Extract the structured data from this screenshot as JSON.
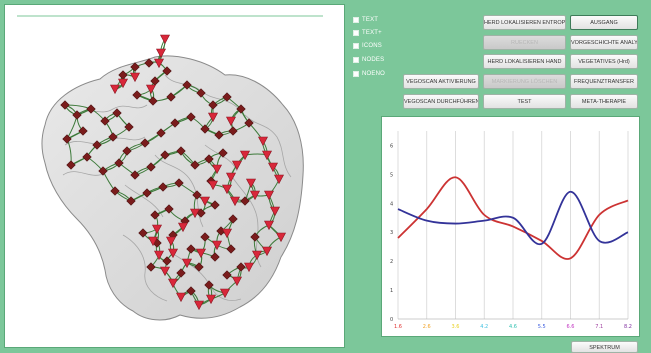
{
  "checks": [
    {
      "label": "TEXT"
    },
    {
      "label": "TEXT+"
    },
    {
      "label": "ICONS"
    },
    {
      "label": "NODES"
    },
    {
      "label": "NOENO"
    }
  ],
  "buttons": {
    "herd_entropie": "HERD LOKALISIEREN ENTROPIE",
    "ausgang": "AUSGANG",
    "blank_disabled": "RUECKEN",
    "vorgeschichte": "VORGESCHICHTE ANALYSE",
    "herd_hand": "HERD LOKALISIEREN HAND",
    "vegetativ": "VEGETATIVES (Hrd)",
    "vegoscan_aktivierung": "VEGOSCAN AKTIVIERUNG",
    "markierungen_loeschen": "MARKIERUNG LÖSCHEN",
    "frequenztransfer": "FREQUENZTRANSFER",
    "vegoscan_durchfuehren": "VEGOSCAN DURCHFÜHREN",
    "test": "TEST",
    "meta_therapie": "META-THERAPIE",
    "spektrum": "SPEKTRUM"
  },
  "chart_data": {
    "type": "line",
    "x": [
      0,
      1,
      2,
      3,
      4,
      5,
      6,
      7,
      8
    ],
    "x_tick_labels": [
      "1.6",
      "2.6",
      "3.6",
      "4.2",
      "4.6",
      "5.5",
      "6.6",
      "7.1",
      "8.2"
    ],
    "x_tick_colors": [
      "#e03030",
      "#f0a020",
      "#e8d020",
      "#40c0e0",
      "#30c0b0",
      "#4060e0",
      "#c030c0",
      "#a040a0",
      "#8030a0"
    ],
    "y_tick_labels": [
      "0",
      "1",
      "2",
      "3",
      "4",
      "5",
      "6"
    ],
    "ylim": [
      0,
      6.5
    ],
    "grid": "vertical",
    "series": [
      {
        "color": "#cc3333",
        "values": [
          2.8,
          3.8,
          4.9,
          3.6,
          3.2,
          2.7,
          2.1,
          3.6,
          4.1
        ]
      },
      {
        "color": "#333399",
        "values": [
          3.8,
          3.4,
          3.3,
          3.4,
          3.5,
          2.6,
          4.4,
          2.7,
          3.0
        ]
      }
    ]
  },
  "colors": {
    "background": "#7cc79a",
    "marker_square": "#7a1c1c",
    "marker_triangle": "#d8283a",
    "vessel": "#3d7a3a"
  }
}
